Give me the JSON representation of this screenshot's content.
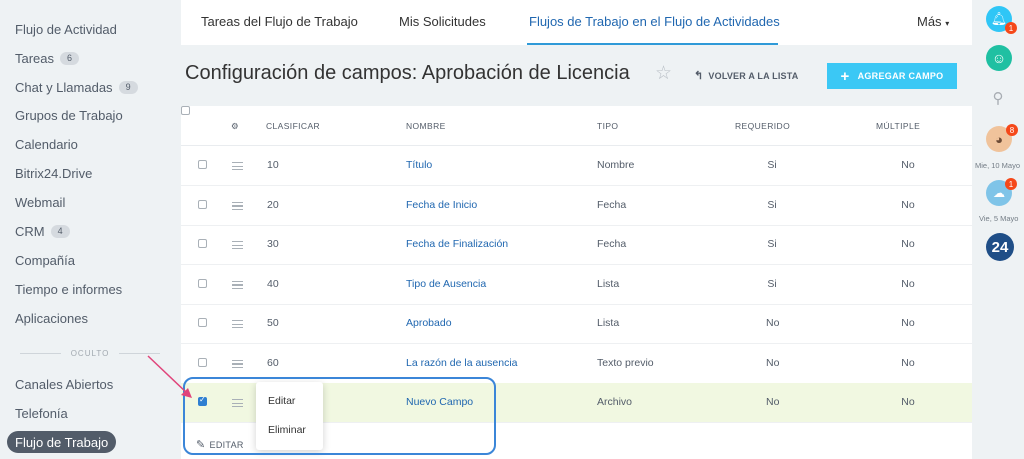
{
  "sidebar": {
    "items": [
      {
        "label": "Flujo de Actividad",
        "count": ""
      },
      {
        "label": "Tareas",
        "count": "6"
      },
      {
        "label": "Chat y Llamadas",
        "count": "9"
      },
      {
        "label": "Grupos de Trabajo",
        "count": ""
      },
      {
        "label": "Calendario",
        "count": ""
      },
      {
        "label": "Bitrix24.Drive",
        "count": ""
      },
      {
        "label": "Webmail",
        "count": ""
      },
      {
        "label": "CRM",
        "count": "4"
      },
      {
        "label": "Compañía",
        "count": ""
      },
      {
        "label": "Tiempo e informes",
        "count": ""
      },
      {
        "label": "Aplicaciones",
        "count": ""
      }
    ],
    "hidden_label": "OCULTO",
    "hidden_items": [
      {
        "label": "Canales Abiertos"
      },
      {
        "label": "Telefonía"
      }
    ],
    "active_item": "Flujo de Trabajo"
  },
  "tabs": [
    {
      "label": "Tareas del Flujo de Trabajo"
    },
    {
      "label": "Mis Solicitudes"
    },
    {
      "label": "Flujos de Trabajo en el Flujo de Actividades"
    },
    {
      "label": "Más"
    }
  ],
  "header": {
    "title": "Configuración de campos: Aprobación de Licencia",
    "back_label": "VOLVER A LA LISTA",
    "add_label": "AGREGAR CAMPO"
  },
  "table": {
    "columns": [
      "CLASIFICAR",
      "NOMBRE",
      "TIPO",
      "REQUERIDO",
      "MÚLTIPLE"
    ],
    "rows": [
      {
        "sort": "10",
        "name": "Título",
        "type": "Nombre",
        "required": "Si",
        "multiple": "No",
        "checked": false
      },
      {
        "sort": "20",
        "name": "Fecha de Inicio",
        "type": "Fecha",
        "required": "Si",
        "multiple": "No",
        "checked": false
      },
      {
        "sort": "30",
        "name": "Fecha de Finalización",
        "type": "Fecha",
        "required": "Si",
        "multiple": "No",
        "checked": false
      },
      {
        "sort": "40",
        "name": "Tipo de Ausencia",
        "type": "Lista",
        "required": "Si",
        "multiple": "No",
        "checked": false
      },
      {
        "sort": "50",
        "name": "Aprobado",
        "type": "Lista",
        "required": "No",
        "multiple": "No",
        "checked": false
      },
      {
        "sort": "60",
        "name": "La razón de la ausencia",
        "type": "Texto previo",
        "required": "No",
        "multiple": "No",
        "checked": false
      },
      {
        "sort": "",
        "name": "Nuevo Campo",
        "type": "Archivo",
        "required": "No",
        "multiple": "No",
        "checked": true
      }
    ],
    "edit_label": "EDITAR"
  },
  "context_menu": {
    "items": [
      "Editar",
      "Eliminar"
    ]
  },
  "right_panel": {
    "notifications_badge": "1",
    "avatar_badge": "8",
    "date_1": "Mie, 10 Mayo",
    "cloud_badge": "1",
    "date_2": "Vie, 5 Mayo",
    "logo": "24"
  },
  "colors": {
    "accent": "#3bc8f5",
    "link": "#2067b0",
    "selected_row": "#f1f8e1",
    "annotation": "#3b86d8",
    "arrow": "#e0457b"
  }
}
